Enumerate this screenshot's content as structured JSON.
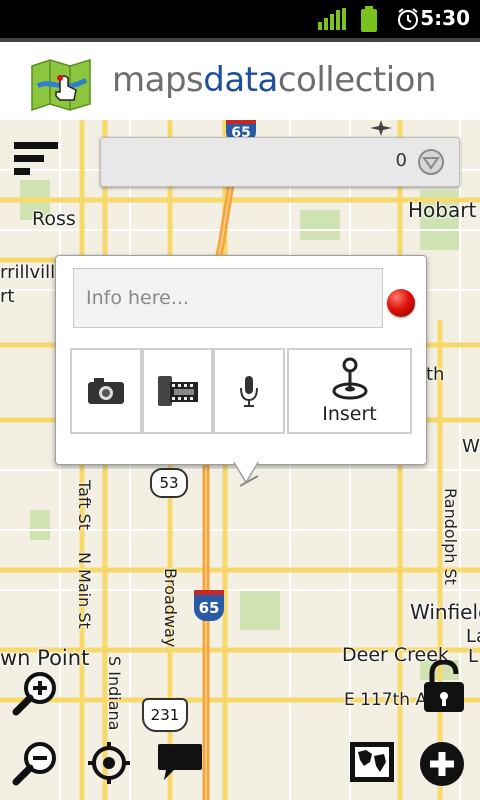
{
  "status_bar": {
    "time": "5:30"
  },
  "app_header": {
    "brand_part1": "maps",
    "brand_part2": "data",
    "brand_part3": "collection"
  },
  "search_bar": {
    "count": "0"
  },
  "popup": {
    "info_placeholder": "Info here...",
    "insert_label": "Insert"
  },
  "map_labels": {
    "ross": "Ross",
    "hobart": "Hobart",
    "merrillville": "rrillvill",
    "merrillville_line2": "rt",
    "th": "th",
    "w": "W",
    "taft": "Taft St",
    "nmain": "N Main St",
    "broadway": "Broadway",
    "randolph": "Randolph St",
    "sindiana": "S Indiana",
    "winfield": "Winfield",
    "deercreek": "Deer Creek",
    "crownpoint": "wn Point",
    "e117": "E 117th A",
    "la": "La",
    "l": "L",
    "route53": "53",
    "i65_top": "65",
    "i65_mid": "65",
    "us231": "231"
  },
  "colors": {
    "brand_gray": "#6d6e71",
    "brand_blue": "#1e4f9d",
    "map_bg": "#f3efe3",
    "highway_orange": "#f4a53c",
    "road_yellow": "#f7d96a",
    "record_red": "#e0120a"
  },
  "icons": [
    "android-signal-icon",
    "battery-icon",
    "alarm-icon",
    "app-logo-icon",
    "menu-icon",
    "dropdown-icon",
    "record-icon",
    "camera-icon",
    "film-icon",
    "microphone-icon",
    "joystick-icon",
    "zoom-in-icon",
    "zoom-out-icon",
    "locate-icon",
    "chat-icon",
    "lock-icon",
    "map-layers-icon",
    "add-icon"
  ]
}
